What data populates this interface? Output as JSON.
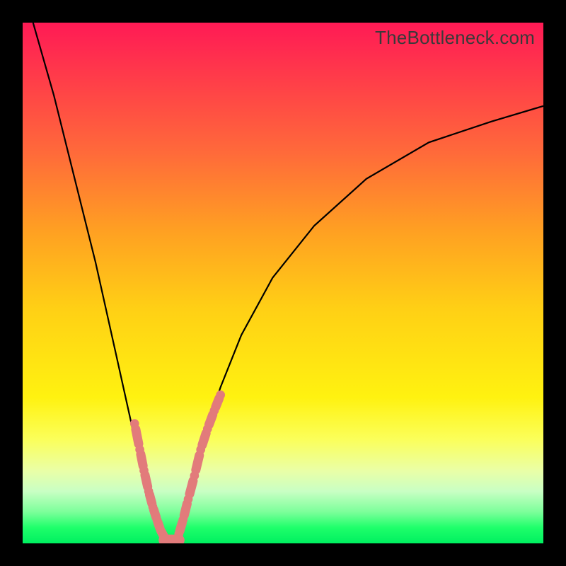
{
  "watermark": "TheBottleneck.com",
  "colors": {
    "frame": "#000000",
    "curve": "#000000",
    "bead": "#e27b7b",
    "gradient_top": "#ff1a55",
    "gradient_bottom": "#00f060"
  },
  "chart_data": {
    "type": "line",
    "title": "",
    "xlabel": "",
    "ylabel": "",
    "xlim": [
      0,
      100
    ],
    "ylim": [
      0,
      100
    ],
    "grid": false,
    "legend": false,
    "notes": "V-shaped bottleneck curve. x ≈ relative hardware balance; y ≈ bottleneck percentage. Minimum (optimal) near x≈28. Salmon capsule markers highlight the near-optimal band on both branches.",
    "series": [
      {
        "name": "bottleneck_curve",
        "x": [
          2,
          6,
          10,
          14,
          18,
          20,
          22,
          24,
          25,
          26,
          27,
          28,
          29,
          30,
          31,
          32,
          34,
          36,
          38,
          42,
          48,
          56,
          66,
          78,
          90,
          100
        ],
        "y": [
          100,
          86,
          70,
          54,
          36,
          27,
          18,
          9,
          5,
          2,
          0.8,
          0.4,
          0.7,
          1.5,
          4,
          8,
          16,
          24,
          30,
          40,
          51,
          61,
          70,
          77,
          81,
          84
        ]
      }
    ],
    "highlighted_points_left": {
      "name": "near_optimal_left_branch",
      "x": [
        21.5,
        22.5,
        23.3,
        24.2,
        25.0,
        25.8,
        26.5,
        27.2
      ],
      "y": [
        23,
        18,
        14,
        10,
        7,
        4.5,
        2.5,
        1.2
      ]
    },
    "highlighted_points_right": {
      "name": "near_optimal_right_branch",
      "x": [
        30.0,
        30.8,
        31.8,
        33.0,
        34.2,
        35.5,
        36.8,
        38.0
      ],
      "y": [
        1.8,
        4.5,
        8.5,
        13,
        18,
        22,
        25.5,
        28.5
      ]
    },
    "trough_segment": {
      "name": "optimal_trough",
      "x": [
        27.2,
        30.0
      ],
      "y": [
        0.6,
        0.6
      ]
    }
  }
}
